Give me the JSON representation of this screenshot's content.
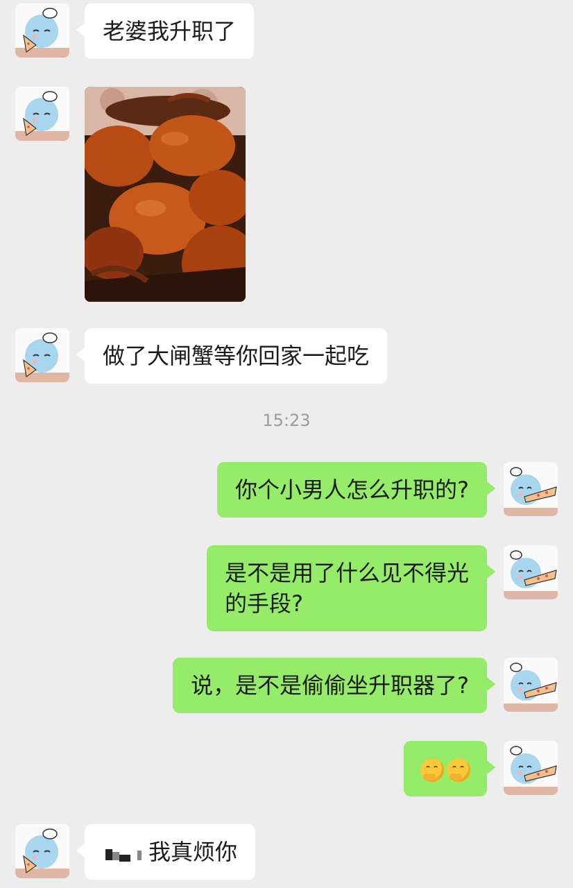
{
  "messages": [
    {
      "side": "left",
      "text": "老婆我升职了"
    },
    {
      "side": "left",
      "type": "image",
      "image_alt": "大闸蟹"
    },
    {
      "side": "left",
      "text": "做了大闸蟹等你回家一起吃"
    },
    {
      "side": "right",
      "text": "你个小男人怎么升职的?"
    },
    {
      "side": "right",
      "line1": "是不是用了什么见不得光",
      "line2": "的手段?"
    },
    {
      "side": "right",
      "text": "说，是不是偷偷坐升职器了?"
    },
    {
      "side": "right",
      "type": "emoji",
      "emoji_icons": [
        "thinking-face-icon",
        "thinking-face-icon"
      ]
    },
    {
      "side": "left",
      "text": "我真烦你",
      "redacted_prefix": true
    }
  ],
  "timestamp": "15:23",
  "colors": {
    "background": "#ededed",
    "incoming_bubble": "#ffffff",
    "outgoing_bubble": "#95ec69",
    "timestamp_text": "#9b9b9b"
  }
}
